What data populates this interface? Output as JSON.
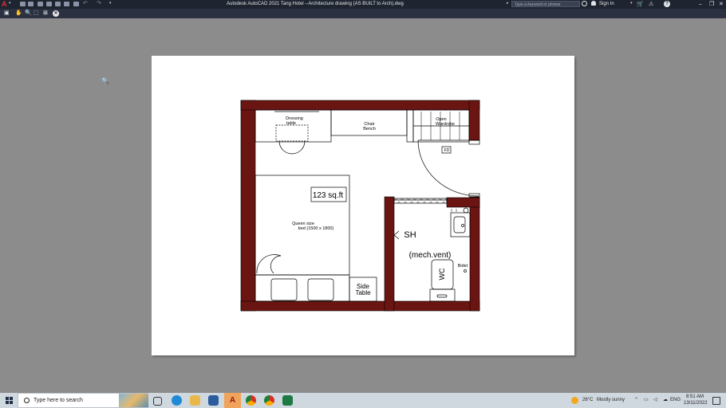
{
  "window": {
    "title": "Autodesk AutoCAD 2021   Tang Hotel --Architecture drawing (AS BUILT to Arch).dwg",
    "search_placeholder": "Type a keyword or phrase",
    "sign_in": "Sign In",
    "help": "?"
  },
  "drawing": {
    "labels": {
      "dressing_1": "Dressing",
      "dressing_2": "table",
      "chair_1": "Chair",
      "chair_2": "Bench",
      "wardrobe_1": "Open",
      "wardrobe_2": "Wardrobe",
      "fd": "FD",
      "area": "123 sq.ft",
      "bed_1": "Queen size",
      "bed_2": "bed (1500 x 1800)",
      "side_1": "Side",
      "side_2": "Table",
      "sh": "SH",
      "vent": "(mech.vent)",
      "bidet": "Bidet",
      "wc": "WC"
    },
    "colors": {
      "wall": "#6b1512",
      "line": "#000000",
      "paper": "#ffffff",
      "canvas": "#8c8c8c"
    }
  },
  "taskbar": {
    "search_placeholder": "Type here to search",
    "weather_temp": "26°C",
    "weather_text": "Mostly sunny",
    "lang": "ENG",
    "time": "8:51 AM",
    "date": "13/11/2022"
  }
}
